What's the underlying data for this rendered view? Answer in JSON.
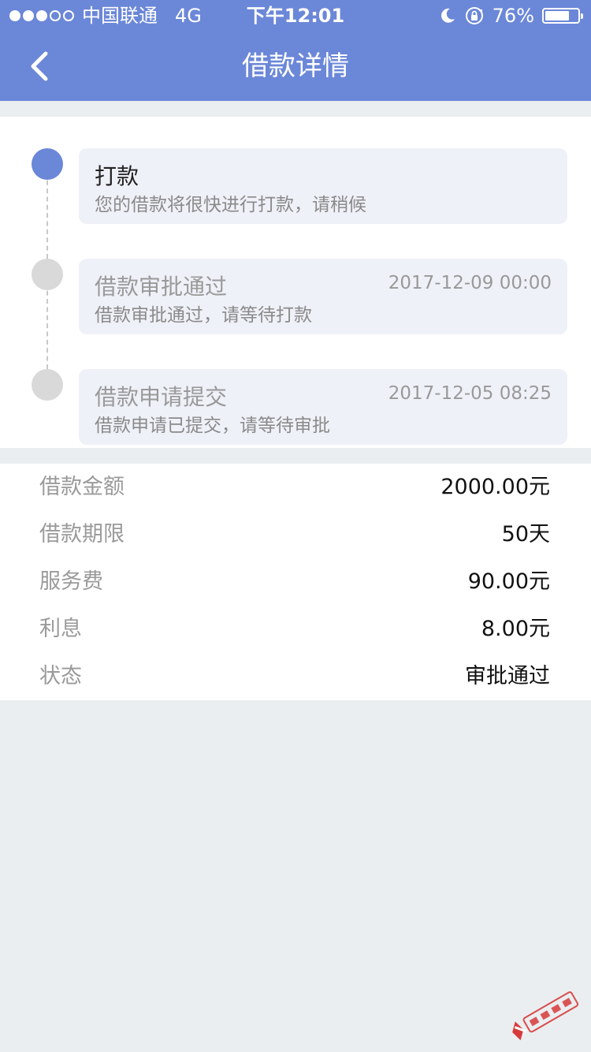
{
  "status_bar": {
    "carrier": "中国联通",
    "network": "4G",
    "time": "下午12:01",
    "battery": "76%",
    "battery_level": 0.76
  },
  "nav": {
    "title": "借款详情"
  },
  "timeline": {
    "steps": [
      {
        "title": "打款",
        "description": "您的借款将很快进行打款，请稍候",
        "time": "",
        "active": true
      },
      {
        "title": "借款审批通过",
        "description": "借款审批通过，请等待打款",
        "time": "2017-12-09 00:00",
        "active": false
      },
      {
        "title": "借款申请提交",
        "description": "借款申请已提交，请等待审批",
        "time": "2017-12-05 08:25",
        "active": false
      }
    ]
  },
  "details": {
    "rows": [
      {
        "label": "借款金额",
        "value": "2000.00元"
      },
      {
        "label": "借款期限",
        "value": "50天"
      },
      {
        "label": "服务费",
        "value": "90.00元"
      },
      {
        "label": "利息",
        "value": "8.00元"
      },
      {
        "label": "状态",
        "value": "审批通过"
      }
    ]
  },
  "colors": {
    "primary": "#6b87d8",
    "inactive_dot": "#d9d9d9",
    "card_bg": "#eff1f8",
    "page_bg": "#ebeef0"
  },
  "icons": {
    "back": "chevron-left-icon",
    "moon": "moon-icon",
    "rotation_lock": "rotation-lock-icon",
    "battery": "battery-icon"
  }
}
